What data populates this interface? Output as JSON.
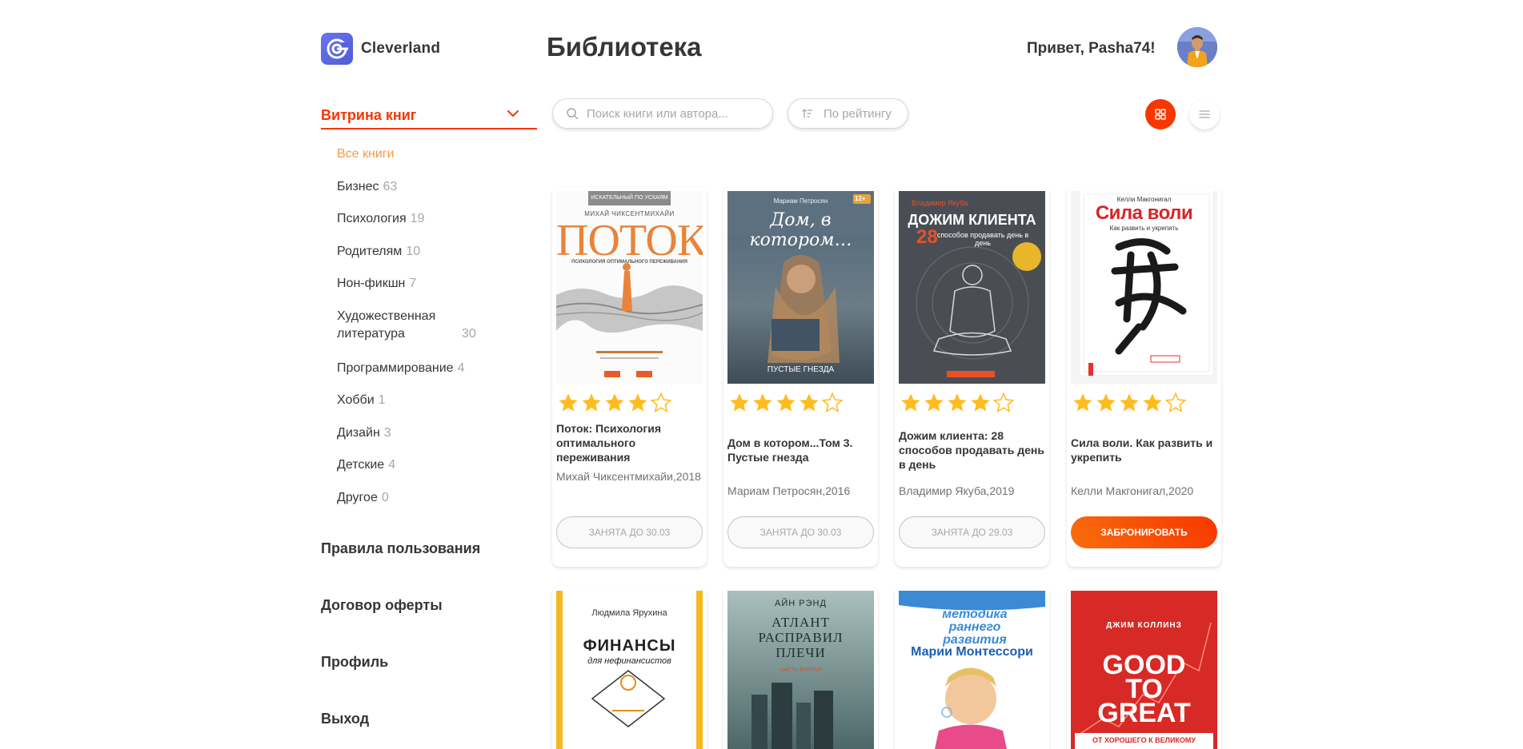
{
  "app": {
    "name": "Cleverland",
    "page_title": "Библиотека",
    "greeting": "Привет, Pasha74!"
  },
  "sidebar": {
    "showcase_label": "Витрина книг",
    "genres": [
      {
        "name": "Все книги",
        "count": ""
      },
      {
        "name": "Бизнес",
        "count": "63"
      },
      {
        "name": "Психология",
        "count": "19"
      },
      {
        "name": "Родителям",
        "count": "10"
      },
      {
        "name": "Нон-фикшн",
        "count": "7"
      },
      {
        "name": "Художественная литература",
        "count": "30"
      },
      {
        "name": "Программирование",
        "count": "4"
      },
      {
        "name": "Хобби",
        "count": "1"
      },
      {
        "name": "Дизайн",
        "count": "3"
      },
      {
        "name": "Детские",
        "count": "4"
      },
      {
        "name": "Другое",
        "count": "0"
      }
    ],
    "links": [
      "Правила пользования",
      "Договор оферты",
      "Профиль",
      "Выход"
    ]
  },
  "toolbar": {
    "search_placeholder": "Поиск книги или автора...",
    "sort_label": "По рейтингу"
  },
  "books": [
    {
      "title": "Поток: Психология оптимального переживания",
      "author": "Михай Чиксентмихайи,2018",
      "rating": 4,
      "button": "Занята до 30.03",
      "available": false,
      "cover": {
        "series": "ИСКАТЕЛЬНЫЙ ПО УСКАЯМ",
        "author": "МИХАЙ ЧИКСЕНТМИХАЙИ",
        "title": "ПОТОК",
        "subtitle": "ПСИХОЛОГИЯ ОПТИМАЛЬНОГО ПЕРЕЖИВАНИЯ"
      }
    },
    {
      "title": "Дом в котором...Том 3. Пустые гнезда",
      "author": "Мариам Петросян,2016",
      "rating": 4,
      "button": "Занята до 30.03",
      "available": false,
      "cover": {
        "author": "Мариам Петросян",
        "title": "Дом, в котором…",
        "subtitle": "ПУСТЫЕ ГНЕЗДА",
        "age": "12+"
      }
    },
    {
      "title": "Дожим клиента: 28 способов продавать день в день",
      "author": "Владимир Якуба,2019",
      "rating": 4,
      "button": "Занята до 29.03",
      "available": false,
      "cover": {
        "author": "Владимир Якуба",
        "title": "ДОЖИМ КЛИЕНТА",
        "number": "28",
        "subtitle": "способов продавать день в день"
      }
    },
    {
      "title": "Сила воли. Как развить и укрепить",
      "author": "Келли Макгонигал,2020",
      "rating": 4,
      "button": "Забронировать",
      "available": true,
      "cover": {
        "author": "Келли Макгонигал",
        "title": "Сила воли",
        "subtitle": "Как развить и укрепить"
      }
    },
    {
      "cover": {
        "author": "Людмила Ярухина",
        "title": "ФИНАНСЫ",
        "subtitle": "для нефинансистов"
      }
    },
    {
      "cover": {
        "author": "АЙН РЭНД",
        "title": "АТЛАНТ РАСПРАВИЛ ПЛЕЧИ",
        "subtitle": "ЧАСТЬ ВТОРАЯ"
      }
    },
    {
      "cover": {
        "title": "методика раннего развития",
        "author": "Марии Монтессори"
      }
    },
    {
      "cover": {
        "author": "ДЖИМ КОЛЛИНЗ",
        "title": "GOOD TO GREAT",
        "subtitle": "ОТ ХОРОШЕГО К ВЕЛИКОМУ"
      }
    }
  ],
  "colors": {
    "accent": "#f83600",
    "accent_light": "#f49b49",
    "star": "#ffbc1f",
    "text": "#363636",
    "muted": "#a7a7a7"
  },
  "icons": {
    "logo": "cleverland-logo-icon",
    "chevron": "chevron-up-icon",
    "search": "search-icon",
    "sort": "sort-icon",
    "grid": "grid-view-icon",
    "list": "list-view-icon"
  }
}
